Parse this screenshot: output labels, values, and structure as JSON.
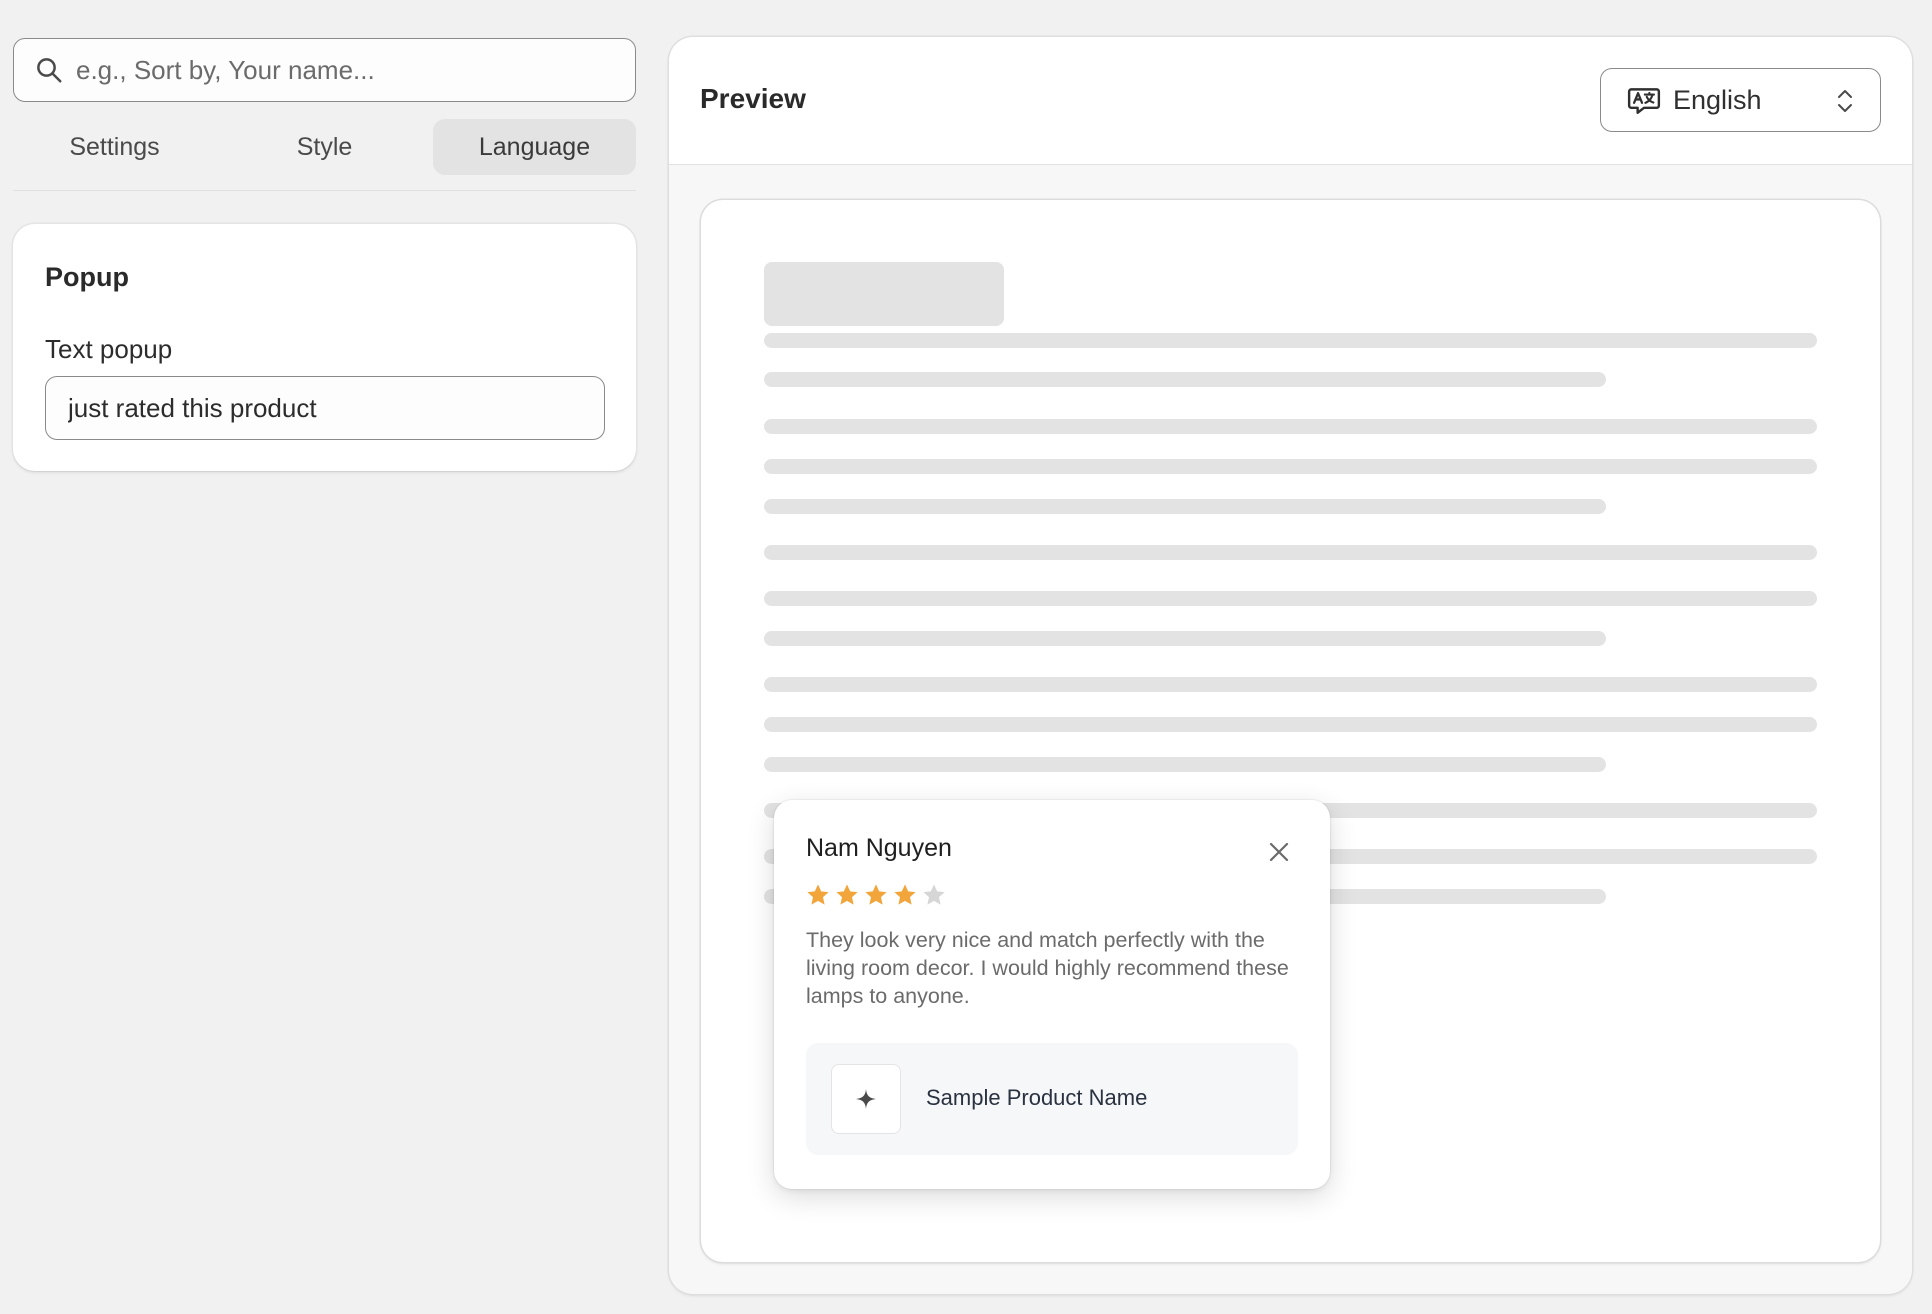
{
  "search": {
    "placeholder": "e.g., Sort by, Your name..."
  },
  "tabs": [
    {
      "label": "Settings",
      "active": false
    },
    {
      "label": "Style",
      "active": false
    },
    {
      "label": "Language",
      "active": true
    }
  ],
  "popup_settings": {
    "section_title": "Popup",
    "text_popup_label": "Text popup",
    "text_popup_value": "just rated this product"
  },
  "preview": {
    "title": "Preview",
    "language": {
      "selected": "English",
      "icon": "translate-icon"
    }
  },
  "review_popup": {
    "reviewer_name": "Nam Nguyen",
    "rating": 4,
    "rating_max": 5,
    "review_text": "They look very nice and match perfectly with the living room decor. I would highly recommend these lamps to anyone.",
    "product_name": "Sample Product Name",
    "product_image_icon": "sparkle-icon",
    "star_color": "#f2a53a",
    "star_empty_color": "#d6d6d6"
  }
}
